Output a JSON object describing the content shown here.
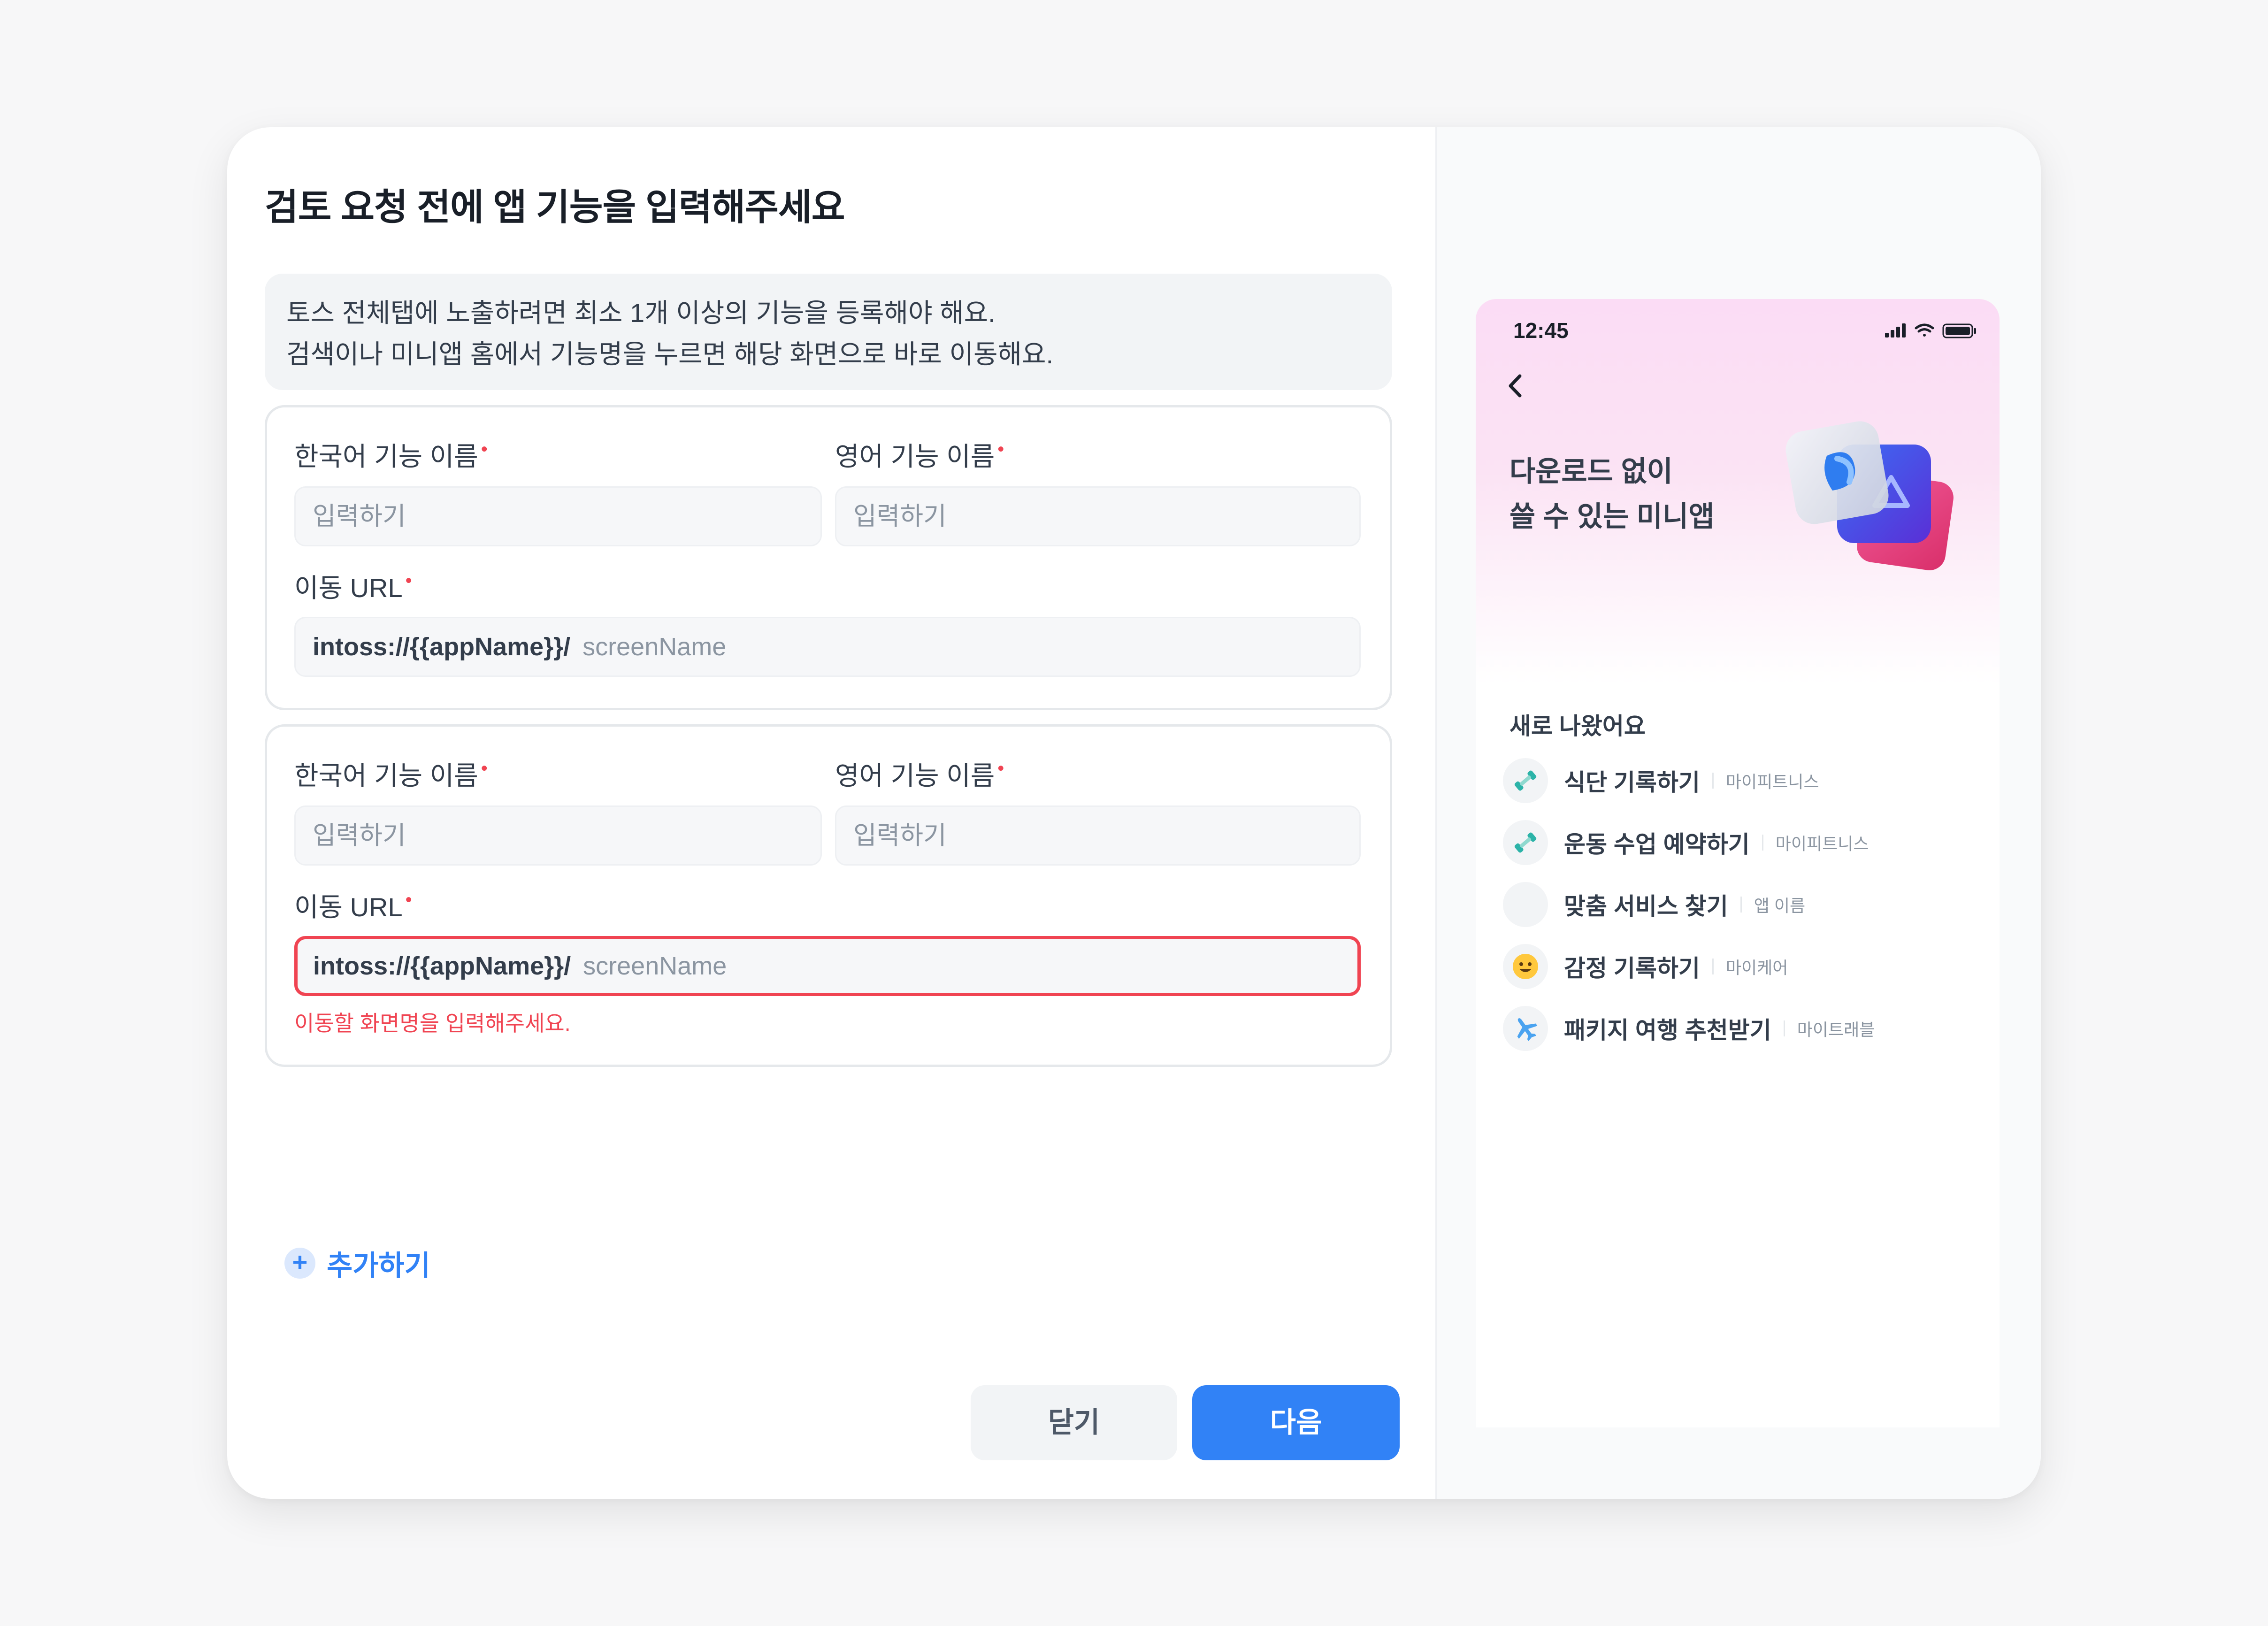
{
  "modal": {
    "title": "검토 요청 전에 앱 기능을 입력해주세요",
    "info_lines": [
      "토스 전체탭에 노출하려면 최소 1개 이상의 기능을 등록해야 해요.",
      "검색이나 미니앱 홈에서 기능명을 누르면 해당 화면으로 바로 이동해요."
    ],
    "required_mark": "•",
    "features": [
      {
        "ko_label": "한국어 기능 이름",
        "en_label": "영어 기능 이름",
        "ko_placeholder": "입력하기",
        "en_placeholder": "입력하기",
        "url_label": "이동 URL",
        "url_prefix": "intoss://{{appName}}/",
        "url_placeholder": "screenName"
      },
      {
        "ko_label": "한국어 기능 이름",
        "en_label": "영어 기능 이름",
        "ko_placeholder": "입력하기",
        "en_placeholder": "입력하기",
        "url_label": "이동 URL",
        "url_prefix": "intoss://{{appName}}/",
        "url_placeholder": "screenName",
        "error": "이동할 화면명을 입력해주세요."
      }
    ],
    "add_label": "추가하기",
    "close_label": "닫기",
    "next_label": "다음"
  },
  "preview": {
    "status_time": "12:45",
    "hero_lines": [
      "다운로드 없이",
      "쓸 수 있는 미니앱"
    ],
    "section_title": "새로 나왔어요",
    "items": [
      {
        "name": "식단 기록하기",
        "app": "마이피트니스",
        "icon": "dumbbell-icon"
      },
      {
        "name": "운동 수업 예약하기",
        "app": "마이피트니스",
        "icon": "dumbbell-icon"
      },
      {
        "name": "맞춤 서비스 찾기",
        "app": "앱 이름",
        "icon": "blank-icon"
      },
      {
        "name": "감정 기록하기",
        "app": "마이케어",
        "icon": "smiley-icon"
      },
      {
        "name": "패키지 여행 추천받기",
        "app": "마이트래블",
        "icon": "airplane-icon"
      }
    ]
  },
  "colors": {
    "primary": "#3182f6",
    "error": "#f04452",
    "text": "#191f28",
    "muted": "#8b95a1"
  }
}
